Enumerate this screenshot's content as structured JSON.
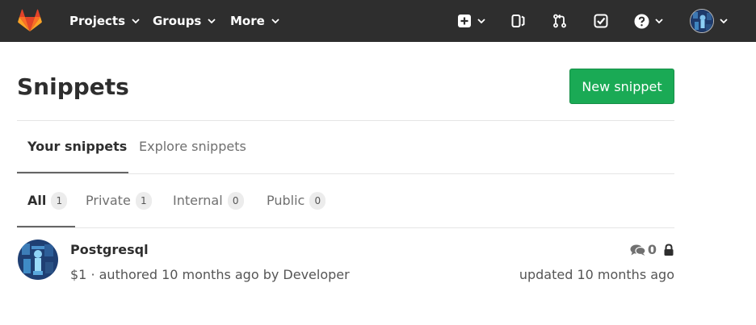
{
  "nav": {
    "projects": "Projects",
    "groups": "Groups",
    "more": "More"
  },
  "page": {
    "title": "Snippets",
    "new_button": "New snippet"
  },
  "tabs": [
    {
      "label": "Your snippets",
      "active": true
    },
    {
      "label": "Explore snippets",
      "active": false
    }
  ],
  "filters": [
    {
      "label": "All",
      "count": "1",
      "active": true
    },
    {
      "label": "Private",
      "count": "1",
      "active": false
    },
    {
      "label": "Internal",
      "count": "0",
      "active": false
    },
    {
      "label": "Public",
      "count": "0",
      "active": false
    }
  ],
  "snippet": {
    "title": "Postgresql",
    "meta": "$1 · authored 10 months ago by Developer",
    "comments": "0",
    "updated": "updated 10 months ago",
    "visibility_icon": "lock-icon"
  },
  "colors": {
    "navbar": "#2e2e2e",
    "primary_button": "#1aaa55"
  }
}
